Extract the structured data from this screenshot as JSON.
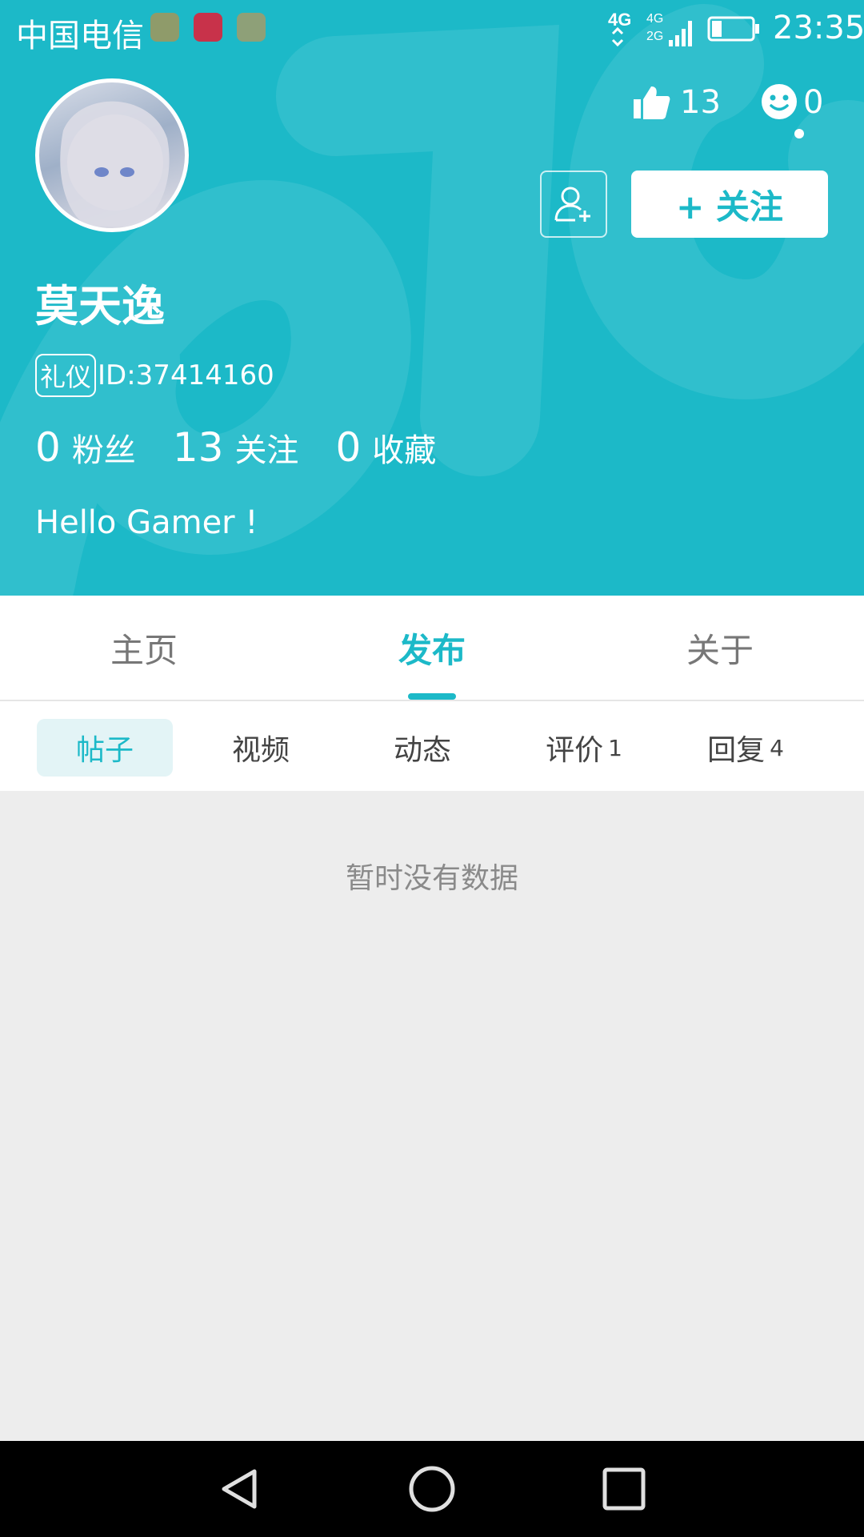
{
  "status_bar": {
    "carrier": "中国电信",
    "network_1": "4G",
    "network_2": "4G",
    "network_3": "2G",
    "time": "23:35",
    "app_icons": [
      "gallery-icon",
      "qidian-icon",
      "game-app-icon"
    ]
  },
  "profile": {
    "likes_count": "13",
    "messages_count": "0",
    "follow_label": "+ 关注",
    "username": "莫天逸",
    "badge": "礼仪",
    "id_text": "ID:37414160",
    "stats": [
      {
        "value": "0",
        "label": "粉丝"
      },
      {
        "value": "13",
        "label": "关注"
      },
      {
        "value": "0",
        "label": "收藏"
      }
    ],
    "bio": "Hello Gamer !"
  },
  "tabs": [
    {
      "label": "主页"
    },
    {
      "label": "发布"
    },
    {
      "label": "关于"
    }
  ],
  "active_tab": "发布",
  "subtabs": [
    {
      "label": "帖子",
      "count": ""
    },
    {
      "label": "视频",
      "count": ""
    },
    {
      "label": "动态",
      "count": ""
    },
    {
      "label": "评价",
      "count": "1"
    },
    {
      "label": "回复",
      "count": "4"
    }
  ],
  "empty_message": "暂时没有数据",
  "colors": {
    "accent": "#1cb9c8",
    "background": "#ededed",
    "nav_bar": "#000000"
  }
}
